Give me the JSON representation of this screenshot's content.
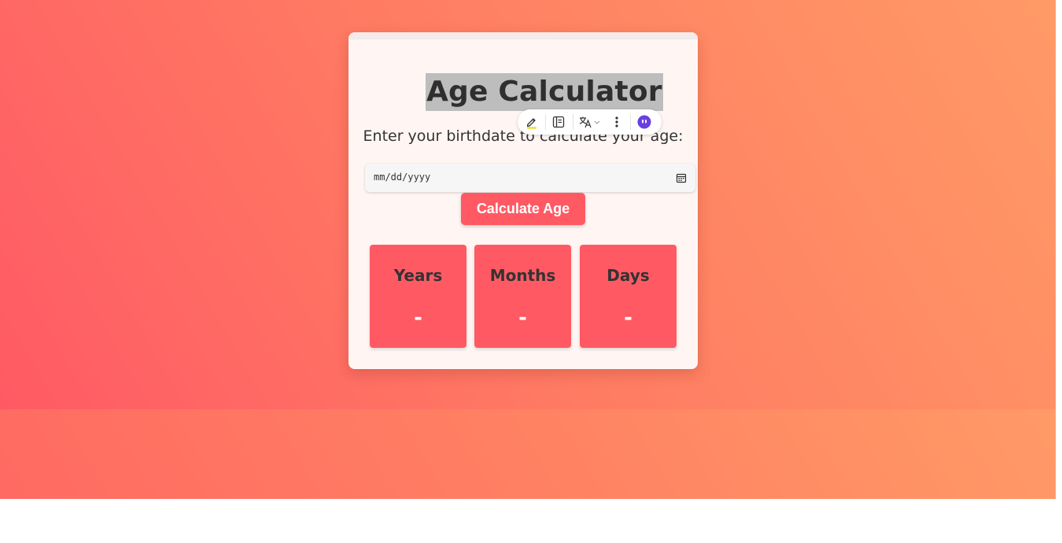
{
  "app": {
    "title": "Age Calculator",
    "subtitle": "Enter your birthdate to calculate your age:"
  },
  "date_input": {
    "placeholder": "mm/dd/yyyy",
    "icon": "calendar-icon"
  },
  "calculate_button": {
    "label": "Calculate Age"
  },
  "results": [
    {
      "label": "Years",
      "value": "-"
    },
    {
      "label": "Months",
      "value": "-"
    },
    {
      "label": "Days",
      "value": "-"
    }
  ],
  "selection_toolbar": {
    "items": [
      "highlight-icon",
      "notes-icon",
      "translate-icon",
      "more-icon",
      "assistant-icon"
    ]
  },
  "colors": {
    "accent": "#ff5a64",
    "gradient_start": "#ff5a64",
    "gradient_end": "#ff9a66",
    "card_bg": "#fff6f4"
  }
}
